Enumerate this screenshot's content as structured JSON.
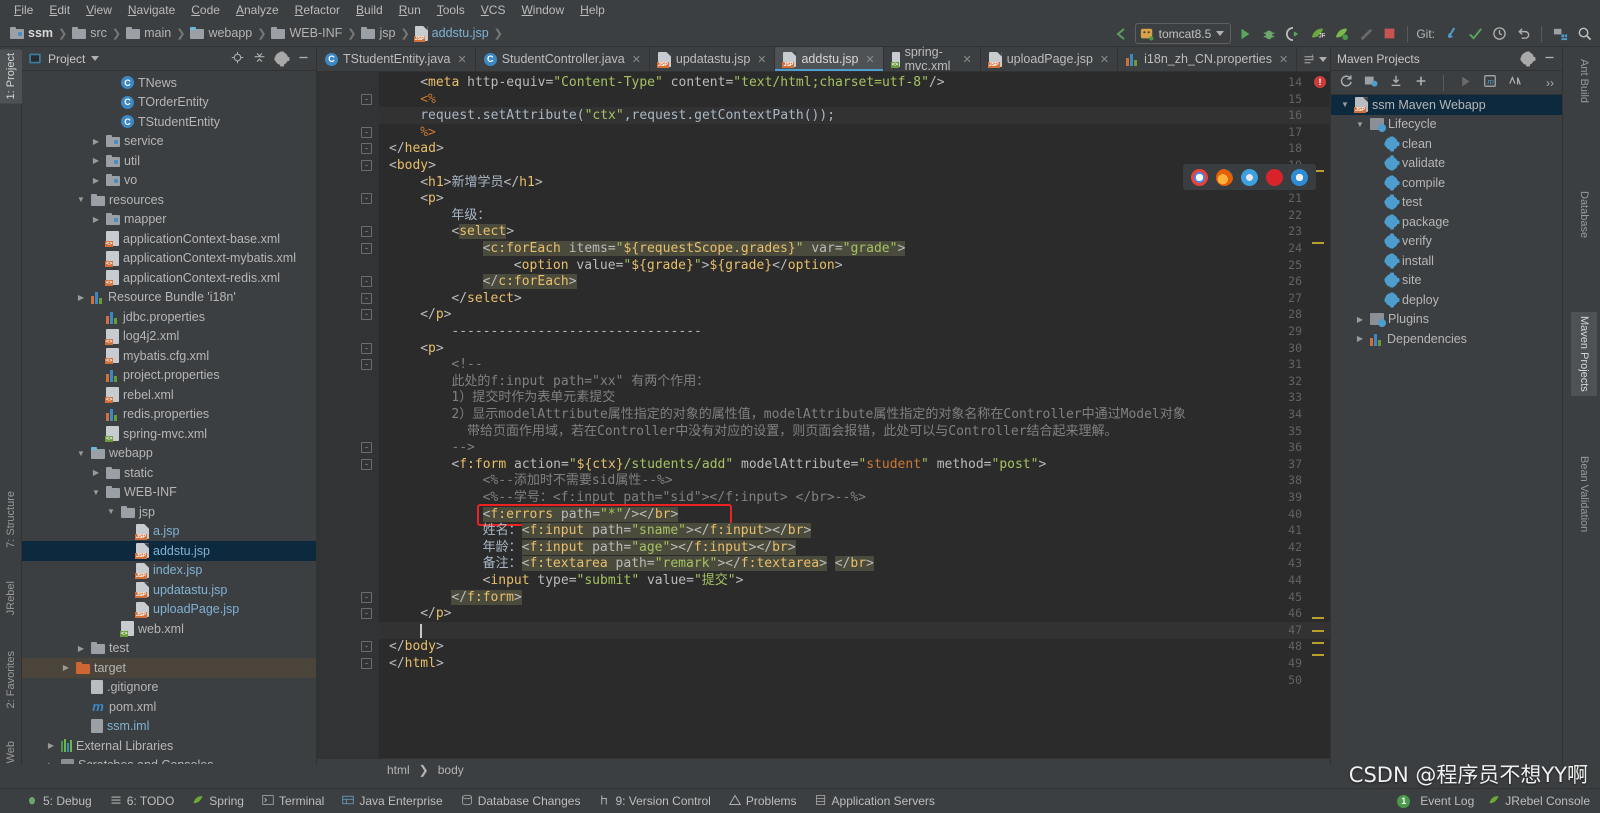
{
  "menu": {
    "items": [
      "File",
      "Edit",
      "View",
      "Navigate",
      "Code",
      "Analyze",
      "Refactor",
      "Build",
      "Run",
      "Tools",
      "VCS",
      "Window",
      "Help"
    ]
  },
  "breadcrumb": {
    "items": [
      {
        "label": "ssm",
        "icon": "module-icon"
      },
      {
        "label": "src",
        "icon": "folder-icon"
      },
      {
        "label": "main",
        "icon": "folder-icon"
      },
      {
        "label": "webapp",
        "icon": "web-folder-icon"
      },
      {
        "label": "WEB-INF",
        "icon": "folder-icon"
      },
      {
        "label": "jsp",
        "icon": "folder-icon"
      },
      {
        "label": "addstu.jsp",
        "icon": "jsp-file-icon"
      }
    ]
  },
  "toolbar": {
    "run_config": "tomcat8.5",
    "git_label": "Git:",
    "icons": [
      "back-arrow-icon",
      "run-icon",
      "debug-icon",
      "run-with-coverage-icon",
      "jrebel-run-icon",
      "jrebel-debug-icon",
      "hammer-icon",
      "stop-icon",
      "update-project-icon",
      "commit-icon",
      "history-icon",
      "rollback-icon",
      "settings-icon",
      "search-everywhere-icon"
    ]
  },
  "left_tool_strip": {
    "items": [
      {
        "label": "1: Project",
        "selected": true
      },
      {
        "label": "7: Structure",
        "selected": false
      },
      {
        "label": "JRebel",
        "selected": false
      },
      {
        "label": "2: Favorites",
        "selected": false
      },
      {
        "label": "Web",
        "selected": false
      }
    ]
  },
  "right_tool_strip": {
    "items": [
      {
        "label": "Ant Build",
        "selected": false
      },
      {
        "label": "Database",
        "selected": false
      },
      {
        "label": "Maven Projects",
        "selected": true
      },
      {
        "label": "Bean Validation",
        "selected": false
      }
    ]
  },
  "project_panel": {
    "title": "Project",
    "header_icons": [
      "locate-icon",
      "collapse-all-icon",
      "gear-icon",
      "hide-icon"
    ],
    "tree": [
      {
        "indent": 5,
        "icon": "class-icon",
        "label": "TNews",
        "arrow": "",
        "sel": false
      },
      {
        "indent": 5,
        "icon": "class-icon",
        "label": "TOrderEntity",
        "arrow": "",
        "sel": false
      },
      {
        "indent": 5,
        "icon": "class-icon",
        "label": "TStudentEntity",
        "arrow": "",
        "sel": false
      },
      {
        "indent": 4,
        "icon": "package-icon",
        "label": "service",
        "arrow": "right",
        "sel": false
      },
      {
        "indent": 4,
        "icon": "package-icon",
        "label": "util",
        "arrow": "right",
        "sel": false
      },
      {
        "indent": 4,
        "icon": "package-icon",
        "label": "vo",
        "arrow": "right",
        "sel": false
      },
      {
        "indent": 3,
        "icon": "resources-folder-icon",
        "label": "resources",
        "arrow": "down",
        "sel": false
      },
      {
        "indent": 4,
        "icon": "package-icon",
        "label": "mapper",
        "arrow": "right",
        "sel": false
      },
      {
        "indent": 4,
        "icon": "xml-icon",
        "label": "applicationContext-base.xml",
        "arrow": "",
        "sel": false
      },
      {
        "indent": 4,
        "icon": "xml-icon",
        "label": "applicationContext-mybatis.xml",
        "arrow": "",
        "sel": false
      },
      {
        "indent": 4,
        "icon": "xml-icon",
        "label": "applicationContext-redis.xml",
        "arrow": "",
        "sel": false
      },
      {
        "indent": 3,
        "icon": "properties-icon",
        "label": "Resource Bundle 'i18n'",
        "arrow": "right",
        "sel": false
      },
      {
        "indent": 4,
        "icon": "properties-icon",
        "label": "jdbc.properties",
        "arrow": "",
        "sel": false
      },
      {
        "indent": 4,
        "icon": "xml-icon",
        "label": "log4j2.xml",
        "arrow": "",
        "sel": false
      },
      {
        "indent": 4,
        "icon": "xml-icon",
        "label": "mybatis.cfg.xml",
        "arrow": "",
        "sel": false
      },
      {
        "indent": 4,
        "icon": "properties-icon",
        "label": "project.properties",
        "arrow": "",
        "sel": false
      },
      {
        "indent": 4,
        "icon": "xml-icon",
        "label": "rebel.xml",
        "arrow": "",
        "sel": false
      },
      {
        "indent": 4,
        "icon": "properties-icon",
        "label": "redis.properties",
        "arrow": "",
        "sel": false
      },
      {
        "indent": 4,
        "icon": "xml-spring-icon",
        "label": "spring-mvc.xml",
        "arrow": "",
        "sel": false
      },
      {
        "indent": 3,
        "icon": "web-folder-icon",
        "label": "webapp",
        "arrow": "down",
        "sel": false
      },
      {
        "indent": 4,
        "icon": "folder-icon",
        "label": "static",
        "arrow": "right",
        "sel": false
      },
      {
        "indent": 4,
        "icon": "folder-icon",
        "label": "WEB-INF",
        "arrow": "down",
        "sel": false
      },
      {
        "indent": 5,
        "icon": "folder-icon",
        "label": "jsp",
        "arrow": "down",
        "sel": false
      },
      {
        "indent": 6,
        "icon": "jsp-file-icon",
        "label": "a.jsp",
        "arrow": "",
        "sel": false
      },
      {
        "indent": 6,
        "icon": "jsp-file-icon",
        "label": "addstu.jsp",
        "arrow": "",
        "sel": true
      },
      {
        "indent": 6,
        "icon": "jsp-file-icon",
        "label": "index.jsp",
        "arrow": "",
        "sel": false
      },
      {
        "indent": 6,
        "icon": "jsp-file-icon",
        "label": "updatastu.jsp",
        "arrow": "",
        "sel": false
      },
      {
        "indent": 6,
        "icon": "jsp-file-icon",
        "label": "uploadPage.jsp",
        "arrow": "",
        "sel": false
      },
      {
        "indent": 5,
        "icon": "web-xml-icon",
        "label": "web.xml",
        "arrow": "",
        "sel": false
      },
      {
        "indent": 3,
        "icon": "folder-icon",
        "label": "test",
        "arrow": "right",
        "sel": false
      },
      {
        "indent": 2,
        "icon": "target-folder-icon",
        "label": "target",
        "arrow": "right",
        "sel2": true
      },
      {
        "indent": 3,
        "icon": "file-icon",
        "label": ".gitignore",
        "arrow": "",
        "sel": false
      },
      {
        "indent": 3,
        "icon": "maven-m-icon",
        "label": "pom.xml",
        "arrow": "",
        "sel": false
      },
      {
        "indent": 3,
        "icon": "iml-icon",
        "label": "ssm.iml",
        "arrow": "",
        "sel": false
      },
      {
        "indent": 1,
        "icon": "library-icon",
        "label": "External Libraries",
        "arrow": "right",
        "sel": false
      },
      {
        "indent": 1,
        "icon": "scratches-icon",
        "label": "Scratches and Consoles",
        "arrow": "right",
        "sel": false
      }
    ]
  },
  "editor": {
    "tabs": [
      {
        "label": "TStudentEntity.java",
        "icon": "class-icon",
        "active": false
      },
      {
        "label": "StudentController.java",
        "icon": "class-icon",
        "active": false
      },
      {
        "label": "updatastu.jsp",
        "icon": "jsp-file-icon",
        "active": false
      },
      {
        "label": "addstu.jsp",
        "icon": "jsp-file-icon",
        "active": true
      },
      {
        "label": "spring-mvc.xml",
        "icon": "xml-spring-icon",
        "active": false
      },
      {
        "label": "uploadPage.jsp",
        "icon": "jsp-file-icon",
        "active": false
      },
      {
        "label": "i18n_zh_CN.properties",
        "icon": "properties-icon",
        "active": false
      }
    ],
    "browser_icons": [
      "chrome-icon",
      "firefox-icon",
      "safari-icon",
      "opera-icon",
      "ie-icon"
    ],
    "first_line_number": 14,
    "lines": [
      {
        "n": 14,
        "indent": 4,
        "fold": "",
        "html": "&lt;<span class='tag'>meta</span> <span class='attr'>http-equiv</span>=<span class='strq'>\"Content-Type\"</span> <span class='attr'>content</span>=<span class='strq'>\"text/html;charset=utf-8\"</span>/&gt;"
      },
      {
        "n": 15,
        "indent": 4,
        "fold": "-",
        "html": "<span class='kw'>&lt;%</span>"
      },
      {
        "n": 16,
        "indent": 4,
        "fold": "",
        "html": "<span class='txt'>request.setAttribute(</span><span class='strq'>\"ctx\"</span><span class='txt'>,request.getContextPath());</span>",
        "caret": true
      },
      {
        "n": 17,
        "indent": 4,
        "fold": "-",
        "html": "<span class='kw'>%&gt;</span>"
      },
      {
        "n": 18,
        "indent": 0,
        "fold": "-",
        "html": "&lt;/<span class='tag'>head</span>&gt;"
      },
      {
        "n": 19,
        "indent": 0,
        "fold": "-",
        "html": "&lt;<span class='tag'>body</span>&gt;"
      },
      {
        "n": 20,
        "indent": 4,
        "fold": "",
        "html": "&lt;<span class='tag'>h1</span>&gt;<span class='txt'>新增学员</span>&lt;/<span class='tag'>h1</span>&gt;"
      },
      {
        "n": 21,
        "indent": 4,
        "fold": "-",
        "html": "&lt;<span class='tag'>p</span>&gt;"
      },
      {
        "n": 22,
        "indent": 8,
        "fold": "",
        "html": "<span class='txt'>年级：</span>"
      },
      {
        "n": 23,
        "indent": 8,
        "fold": "-",
        "html": "&lt;<span class='tag hl'>select</span>&gt;"
      },
      {
        "n": 24,
        "indent": 12,
        "fold": "-",
        "html": "<span class='hl'>&lt;<span class='tag'>c:forEach</span> <span class='attr'>items</span>=<span class='strq'>\"</span><span class='el'>${requestScope.grades}</span><span class='strq'>\"</span> <span class='attr'>var</span>=<span class='strq'>\"grade\"</span>&gt;</span>"
      },
      {
        "n": 25,
        "indent": 16,
        "fold": "",
        "html": "&lt;<span class='tag'>option</span> <span class='attr'>value</span>=<span class='strq'>\"</span><span class='el'>${grade}</span><span class='strq'>\"</span>&gt;<span class='el'>${grade}</span>&lt;/<span class='tag'>option</span>&gt;"
      },
      {
        "n": 26,
        "indent": 12,
        "fold": "-",
        "html": "<span class='hl'>&lt;/<span class='tag'>c:forEach</span>&gt;</span>"
      },
      {
        "n": 27,
        "indent": 8,
        "fold": "-",
        "html": "&lt;/<span class='tag'>select</span>&gt;"
      },
      {
        "n": 28,
        "indent": 4,
        "fold": "-",
        "html": "&lt;/<span class='tag'>p</span>&gt;"
      },
      {
        "n": 29,
        "indent": 8,
        "fold": "",
        "html": "<span class='txt'>--------------------------------</span>"
      },
      {
        "n": 30,
        "indent": 4,
        "fold": "-",
        "html": "&lt;<span class='tag'>p</span>&gt;"
      },
      {
        "n": 31,
        "indent": 8,
        "fold": "-",
        "html": "<span class='cmt'>&lt;!--</span>"
      },
      {
        "n": 32,
        "indent": 8,
        "fold": "",
        "html": "<span class='cmt'>此处的f:input path=\"xx\" 有两个作用：</span>"
      },
      {
        "n": 33,
        "indent": 8,
        "fold": "",
        "html": "<span class='cmt'>1）提交时作为表单元素提交</span>"
      },
      {
        "n": 34,
        "indent": 8,
        "fold": "",
        "html": "<span class='cmt'>2）显示modelAttribute属性指定的对象的属性值，modelAttribute属性指定的对象名称在Controller中通过Model对象</span>"
      },
      {
        "n": 35,
        "indent": 10,
        "fold": "",
        "html": "<span class='cmt'>带给页面作用域，若在Controller中没有对应的设置，则页面会报错，此处可以与Controller结合起来理解。</span>"
      },
      {
        "n": 36,
        "indent": 8,
        "fold": "-",
        "html": "<span class='cmt'>--&gt;</span>"
      },
      {
        "n": 37,
        "indent": 8,
        "fold": "-",
        "html": "&lt;<span class='tag'>f:form</span> <span class='attr'>action</span>=<span class='strq'>\"</span><span class='el'>${ctx}</span><span class='strq'>/students/add\"</span> <span class='attr'>modelAttribute</span>=<span class='strq'>\"</span><span class='str' style='color:#cc7832'>student</span><span class='strq'>\"</span> <span class='attr'>method</span>=<span class='strq'>\"post\"</span>&gt;"
      },
      {
        "n": 38,
        "indent": 12,
        "fold": "",
        "html": "<span class='cmt'>&lt;%--添加时不需要sid属性--%&gt;</span>"
      },
      {
        "n": 39,
        "indent": 12,
        "fold": "",
        "html": "<span class='cmt'>&lt;%--学号：&lt;f:input path=\"sid\"&gt;&lt;/f:input&gt; &lt;/br&gt;--%&gt;</span>"
      },
      {
        "n": 40,
        "indent": 12,
        "fold": "",
        "html": "<span class='hl'>&lt;<span class='tag'>f:errors</span> <span class='attr'>path</span>=<span class='strq'>\"*\"</span>/&gt;&lt;/<span class='tag'>br</span>&gt;</span>",
        "boxed": true
      },
      {
        "n": 41,
        "indent": 12,
        "fold": "",
        "html": "<span class='txt'>姓名：</span><span class='hl'>&lt;<span class='tag'>f:input</span> <span class='attr'>path</span>=<span class='strq'>\"sname\"</span>&gt;&lt;/<span class='tag'>f:input</span>&gt;&lt;/<span class='tag'>br</span>&gt;</span>"
      },
      {
        "n": 42,
        "indent": 12,
        "fold": "",
        "html": "<span class='txt'>年龄：</span><span class='hl'>&lt;<span class='tag'>f:input</span> <span class='attr'>path</span>=<span class='strq'>\"age\"</span>&gt;&lt;/<span class='tag'>f:input</span>&gt;&lt;/<span class='tag'>br</span>&gt;</span>"
      },
      {
        "n": 43,
        "indent": 12,
        "fold": "",
        "html": "<span class='txt'>备注：</span><span class='hl'>&lt;<span class='tag'>f:textarea</span> <span class='attr'>path</span>=<span class='strq'>\"remark\"</span>&gt;&lt;/<span class='tag'>f:textarea</span>&gt;</span> <span class='hl'>&lt;/<span class='tag'>br</span>&gt;</span>"
      },
      {
        "n": 44,
        "indent": 12,
        "fold": "",
        "html": "&lt;<span class='tag'>input</span> <span class='attr'>type</span>=<span class='strq'>\"submit\"</span> <span class='attr'>value</span>=<span class='strq'>\"提交\"</span>&gt;"
      },
      {
        "n": 45,
        "indent": 8,
        "fold": "-",
        "html": "<span class='hl'>&lt;/<span class='tag'>f:form</span>&gt;</span>"
      },
      {
        "n": 46,
        "indent": 4,
        "fold": "-",
        "html": "&lt;/<span class='tag'>p</span>&gt;"
      },
      {
        "n": 47,
        "indent": 4,
        "fold": "",
        "html": "",
        "caret2": true
      },
      {
        "n": 48,
        "indent": 0,
        "fold": "-",
        "html": "&lt;/<span class='tag'>body</span>&gt;"
      },
      {
        "n": 49,
        "indent": 0,
        "fold": "-",
        "html": "&lt;/<span class='tag'>html</span>&gt;"
      },
      {
        "n": 50,
        "indent": 0,
        "fold": "",
        "html": ""
      }
    ],
    "breadcrumbs": [
      "html",
      "body"
    ]
  },
  "maven_panel": {
    "title": "Maven Projects",
    "toolbar_icons": [
      "reimport-icon",
      "generate-sources-icon",
      "download-sources-icon",
      "add-icon",
      "run-icon",
      "execute-goal-icon",
      "toggle-skip-tests-icon",
      "more-icon"
    ],
    "header_icons": [
      "gear-icon",
      "hide-icon"
    ],
    "tree": [
      {
        "indent": 0,
        "arrow": "down",
        "icon": "maven-project-icon",
        "label": "ssm Maven Webapp",
        "sel": true
      },
      {
        "indent": 1,
        "arrow": "down",
        "icon": "phase-folder-icon",
        "label": "Lifecycle",
        "sel": false
      },
      {
        "indent": 2,
        "arrow": "",
        "icon": "gear-icon",
        "label": "clean",
        "sel": false
      },
      {
        "indent": 2,
        "arrow": "",
        "icon": "gear-icon",
        "label": "validate",
        "sel": false
      },
      {
        "indent": 2,
        "arrow": "",
        "icon": "gear-icon",
        "label": "compile",
        "sel": false
      },
      {
        "indent": 2,
        "arrow": "",
        "icon": "gear-icon",
        "label": "test",
        "sel": false
      },
      {
        "indent": 2,
        "arrow": "",
        "icon": "gear-icon",
        "label": "package",
        "sel": false
      },
      {
        "indent": 2,
        "arrow": "",
        "icon": "gear-icon",
        "label": "verify",
        "sel": false
      },
      {
        "indent": 2,
        "arrow": "",
        "icon": "gear-icon",
        "label": "install",
        "sel": false
      },
      {
        "indent": 2,
        "arrow": "",
        "icon": "gear-icon",
        "label": "site",
        "sel": false
      },
      {
        "indent": 2,
        "arrow": "",
        "icon": "gear-icon",
        "label": "deploy",
        "sel": false
      },
      {
        "indent": 1,
        "arrow": "right",
        "icon": "phase-folder-icon",
        "label": "Plugins",
        "sel": false
      },
      {
        "indent": 1,
        "arrow": "right",
        "icon": "dependencies-icon",
        "label": "Dependencies",
        "sel": false
      }
    ]
  },
  "status_bar": {
    "left_items": [
      {
        "label": "5: Debug",
        "icon": "debug-icon"
      },
      {
        "label": "6: TODO",
        "icon": "todo-icon"
      },
      {
        "label": "Spring",
        "icon": "spring-leaf-icon"
      },
      {
        "label": "Terminal",
        "icon": "terminal-icon"
      },
      {
        "label": "Java Enterprise",
        "icon": "java-ee-icon"
      },
      {
        "label": "Database Changes",
        "icon": "database-changes-icon"
      },
      {
        "label": "9: Version Control",
        "icon": "version-control-icon"
      },
      {
        "label": "Problems",
        "icon": "problems-icon"
      },
      {
        "label": "Application Servers",
        "icon": "application-servers-icon"
      }
    ],
    "right_items": [
      {
        "label": "Event Log",
        "icon": "event-log-icon",
        "badge": "1"
      },
      {
        "label": "JRebel Console",
        "icon": "jrebel-icon",
        "badge": ""
      }
    ]
  },
  "watermark": "CSDN @程序员不想YY啊",
  "colors": {
    "accent": "#4d9ecf",
    "selection": "#0d293e",
    "editor_bg": "#2b2b2b",
    "panel_bg": "#3c3f41",
    "error_red": "#ee2222",
    "string_green": "#6a8759",
    "tag_yellow": "#e8bf6a",
    "keyword_orange": "#cc7832"
  }
}
